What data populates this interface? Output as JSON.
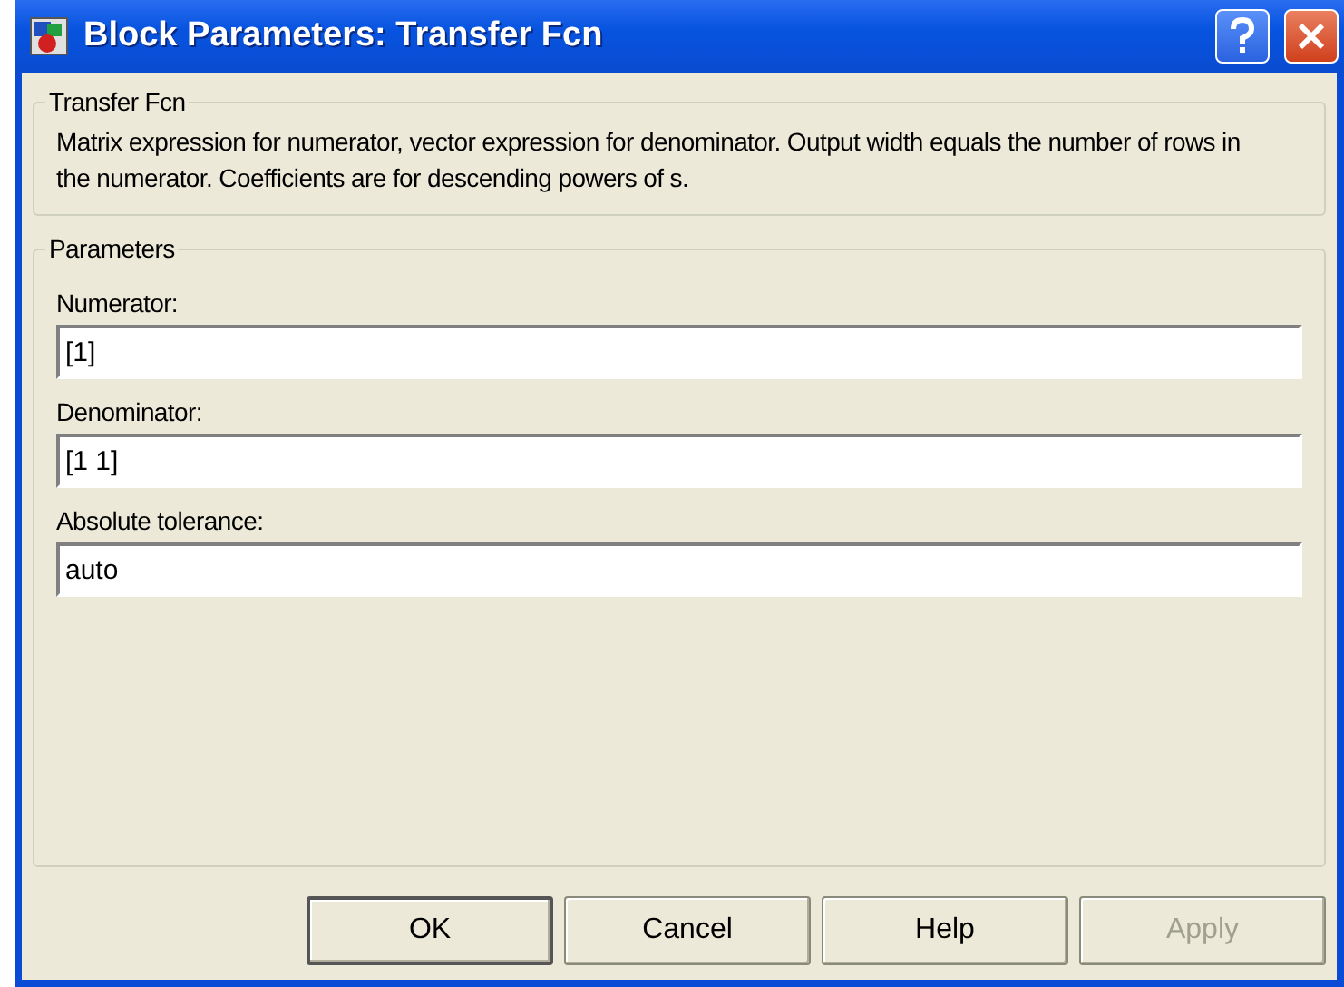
{
  "window": {
    "title": "Block Parameters: Transfer Fcn"
  },
  "description_group": {
    "title": "Transfer Fcn",
    "text": "Matrix expression for numerator, vector expression for denominator.  Output width equals the number of rows in the numerator.  Coefficients are for descending powers of s."
  },
  "parameters_group": {
    "title": "Parameters",
    "fields": [
      {
        "label": "Numerator:",
        "value": "[1]"
      },
      {
        "label": "Denominator:",
        "value": "[1 1]"
      },
      {
        "label": "Absolute tolerance:",
        "value": "auto"
      }
    ]
  },
  "buttons": [
    {
      "label": "OK",
      "disabled": false,
      "default": true
    },
    {
      "label": "Cancel",
      "disabled": false,
      "default": false
    },
    {
      "label": "Help",
      "disabled": false,
      "default": false
    },
    {
      "label": "Apply",
      "disabled": true,
      "default": false
    }
  ]
}
